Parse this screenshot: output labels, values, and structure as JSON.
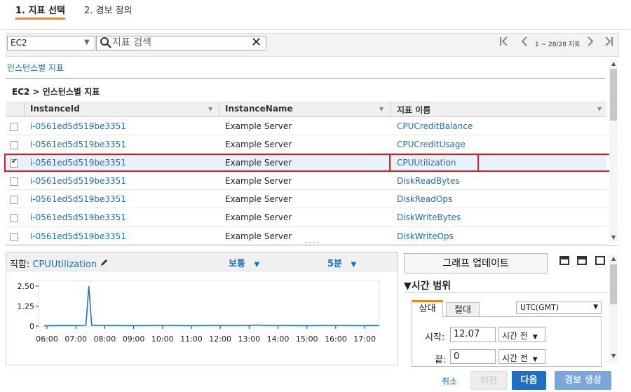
{
  "steps": [
    {
      "label": "1. 지표 선택"
    },
    {
      "label": "2. 경보 정의"
    }
  ],
  "toolbar": {
    "namespace": "EC2",
    "search_placeholder": "지표 검색",
    "pager_text": "1 ~ 28/28 지표"
  },
  "breadcrumb_link": "인스턴스별 지표",
  "table": {
    "title": "EC2 > 인스턴스별 지표",
    "headers": [
      "InstanceId",
      "InstanceName",
      "지표 이름"
    ],
    "rows": [
      {
        "id": "i-0561ed5d519be3351",
        "name": "Example Server",
        "metric": "CPUCreditBalance",
        "checked": false
      },
      {
        "id": "i-0561ed5d519be3351",
        "name": "Example Server",
        "metric": "CPUCreditUsage",
        "checked": false
      },
      {
        "id": "i-0561ed5d519be3351",
        "name": "Example Server",
        "metric": "CPUUtilization",
        "checked": true
      },
      {
        "id": "i-0561ed5d519be3351",
        "name": "Example Server",
        "metric": "DiskReadBytes",
        "checked": false
      },
      {
        "id": "i-0561ed5d519be3351",
        "name": "Example Server",
        "metric": "DiskReadOps",
        "checked": false
      },
      {
        "id": "i-0561ed5d519be3351",
        "name": "Example Server",
        "metric": "DiskWriteBytes",
        "checked": false
      },
      {
        "id": "i-0561ed5d519be3351",
        "name": "Example Server",
        "metric": "DiskWriteOps",
        "checked": false
      }
    ]
  },
  "graph": {
    "title_prefix": "직함:",
    "metric": "CPUUtilization",
    "stat": "보통",
    "period": "5분"
  },
  "chart_data": {
    "type": "line",
    "title": "",
    "xlabel": "",
    "ylabel": "",
    "x_ticks": [
      "06:00",
      "07:00",
      "08:00",
      "09:00",
      "10:00",
      "11:00",
      "12:00",
      "13:00",
      "14:00",
      "15:00",
      "16:00",
      "17:00"
    ],
    "y_ticks": [
      "0",
      "1.25",
      "2.50"
    ],
    "ylim": [
      0,
      2.5
    ],
    "series": [
      {
        "x": [
          5.9,
          6.2,
          6.6,
          7.0,
          7.35,
          7.45,
          7.55,
          8.0,
          9.0,
          10.0,
          11.0,
          12.0,
          13.0,
          13.3,
          13.5,
          14.0,
          15.0,
          16.0,
          17.0,
          17.5
        ],
        "values": [
          0.02,
          0.03,
          0.04,
          0.03,
          0.05,
          2.5,
          0.05,
          0.04,
          0.03,
          0.04,
          0.03,
          0.04,
          0.04,
          0.07,
          0.04,
          0.04,
          0.03,
          0.04,
          0.03,
          0.04
        ]
      }
    ],
    "color": "#1a78c2"
  },
  "right_panel": {
    "update_button": "그래프 업데이트",
    "time_range_header": "▼시간 범위",
    "tabs": [
      "상대",
      "절대"
    ],
    "timezone": "UTC(GMT)",
    "start_label": "시작:",
    "start_value": "12.07",
    "start_unit": "시간 전",
    "end_label": "끝:",
    "end_value": "0",
    "end_unit": "시간 전"
  },
  "footer": {
    "cancel": "취소",
    "prev": "이전",
    "next": "다음",
    "create": "경보 생성"
  }
}
